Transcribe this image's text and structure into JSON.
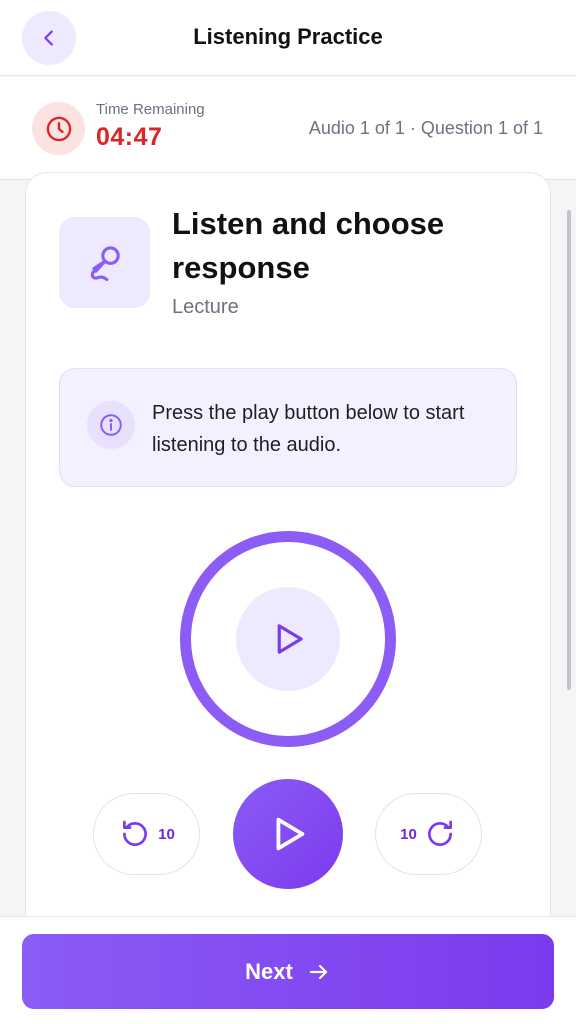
{
  "header": {
    "title": "Listening Practice",
    "back_icon": "chevron-left-icon"
  },
  "timer": {
    "label": "Time Remaining",
    "value": "04:47",
    "icon": "clock-icon",
    "progress": "Audio 1 of 1 · Question 1 of 1"
  },
  "task": {
    "icon": "microphone-icon",
    "title": "Listen and choose response",
    "subtitle": "Lecture"
  },
  "info": {
    "icon": "info-icon",
    "text": "Press the play button below to start listening to the audio."
  },
  "player": {
    "skip_back_label": "10",
    "skip_forward_label": "10"
  },
  "footer": {
    "next_label": "Next"
  },
  "colors": {
    "accent": "#8b5cf6",
    "accent_dark": "#7c3aed",
    "accent_light": "#ede9fe",
    "timer_red": "#dc2626",
    "timer_bg": "#fde2e2"
  }
}
